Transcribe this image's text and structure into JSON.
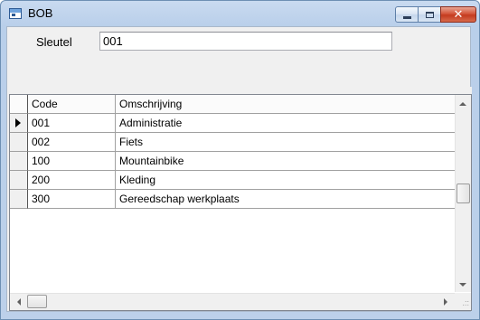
{
  "window": {
    "title": "BOB",
    "minimize_icon": "minimize-icon",
    "maximize_icon": "maximize-icon",
    "close_icon": "close-icon",
    "close_glyph": "✕",
    "close_color": "#c43b1f"
  },
  "form": {
    "key_label": "Sleutel",
    "key_value": "001"
  },
  "grid": {
    "columns": [
      "Code",
      "Omschrijving"
    ],
    "current_row_indicator": "row-pointer-icon",
    "rows": [
      {
        "code": "001",
        "description": "Administratie"
      },
      {
        "code": "002",
        "description": "Fiets"
      },
      {
        "code": "100",
        "description": "Mountainbike"
      },
      {
        "code": "200",
        "description": "Kleding"
      },
      {
        "code": "300",
        "description": "Gereedschap werkplaats"
      }
    ]
  }
}
